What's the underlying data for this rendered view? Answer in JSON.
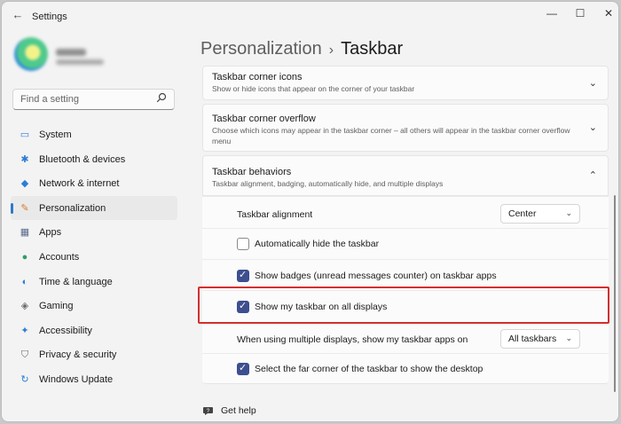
{
  "window": {
    "app_title": "Settings",
    "controls": {
      "minimize": "—",
      "maximize": "☐",
      "close": "✕"
    }
  },
  "sidebar": {
    "search_placeholder": "Find a setting",
    "items": [
      {
        "label": "System",
        "icon": "monitor-icon",
        "glyph": "▭",
        "color": "#3a7bd5"
      },
      {
        "label": "Bluetooth & devices",
        "icon": "bluetooth-icon",
        "glyph": "✱",
        "color": "#2b7ed6"
      },
      {
        "label": "Network & internet",
        "icon": "wifi-icon",
        "glyph": "◆",
        "color": "#2b7ed6"
      },
      {
        "label": "Personalization",
        "icon": "brush-icon",
        "glyph": "✎",
        "color": "#d97a2b"
      },
      {
        "label": "Apps",
        "icon": "apps-icon",
        "glyph": "▦",
        "color": "#5a6b8c"
      },
      {
        "label": "Accounts",
        "icon": "person-icon",
        "glyph": "●",
        "color": "#2e9e6b"
      },
      {
        "label": "Time & language",
        "icon": "globe-icon",
        "glyph": "◐",
        "color": "#2b7ed6"
      },
      {
        "label": "Gaming",
        "icon": "gamepad-icon",
        "glyph": "◈",
        "color": "#6b6b6b"
      },
      {
        "label": "Accessibility",
        "icon": "accessibility-icon",
        "glyph": "✦",
        "color": "#2b7ed6"
      },
      {
        "label": "Privacy & security",
        "icon": "shield-icon",
        "glyph": "⛉",
        "color": "#6b6b6b"
      },
      {
        "label": "Windows Update",
        "icon": "update-icon",
        "glyph": "↻",
        "color": "#2b7ed6"
      }
    ],
    "active_index": 3
  },
  "breadcrumb": {
    "parent": "Personalization",
    "separator": "›",
    "current": "Taskbar"
  },
  "sections": {
    "corner_icons": {
      "title": "Taskbar corner icons",
      "desc": "Show or hide icons that appear on the corner of your taskbar"
    },
    "corner_overflow": {
      "title": "Taskbar corner overflow",
      "desc": "Choose which icons may appear in the taskbar corner – all others will appear in the taskbar corner overflow menu"
    },
    "behaviors": {
      "title": "Taskbar behaviors",
      "desc": "Taskbar alignment, badging, automatically hide, and multiple displays"
    }
  },
  "behaviors": {
    "alignment_label": "Taskbar alignment",
    "alignment_value": "Center",
    "autohide_label": "Automatically hide the taskbar",
    "badges_label": "Show badges (unread messages counter) on taskbar apps",
    "all_displays_label": "Show my taskbar on all displays",
    "multi_label": "When using multiple displays, show my taskbar apps on",
    "multi_value": "All taskbars",
    "far_corner_label": "Select the far corner of the taskbar to show the desktop"
  },
  "help": {
    "label": "Get help"
  },
  "colors": {
    "accent": "#3d4f8f",
    "highlight": "#d32f2f"
  }
}
